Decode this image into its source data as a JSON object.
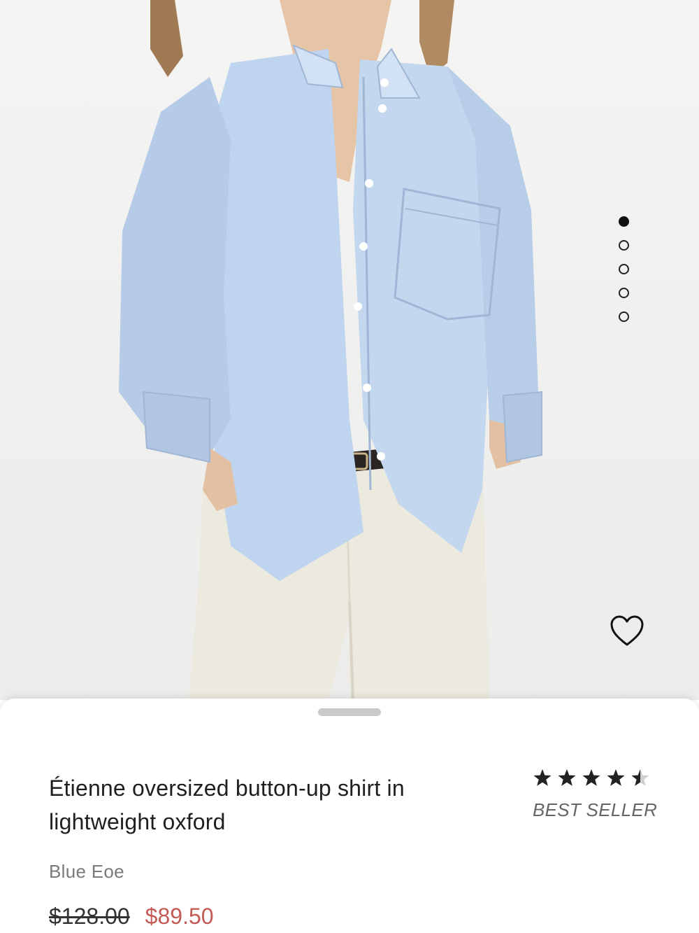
{
  "carousel": {
    "total": 5,
    "active_index": 0
  },
  "product": {
    "title": "Étienne oversized button-up shirt in lightweight oxford",
    "brand": "Blue Eoe",
    "original_price": "$128.00",
    "sale_price": "$89.50",
    "rating": 4.5,
    "badge": "BEST SELLER"
  },
  "icons": {
    "favorite": "heart-outline-icon",
    "star": "star-icon"
  },
  "colors": {
    "sale_price": "#c25b55",
    "shirt": "#bfd4ee",
    "pants": "#ece9df"
  }
}
